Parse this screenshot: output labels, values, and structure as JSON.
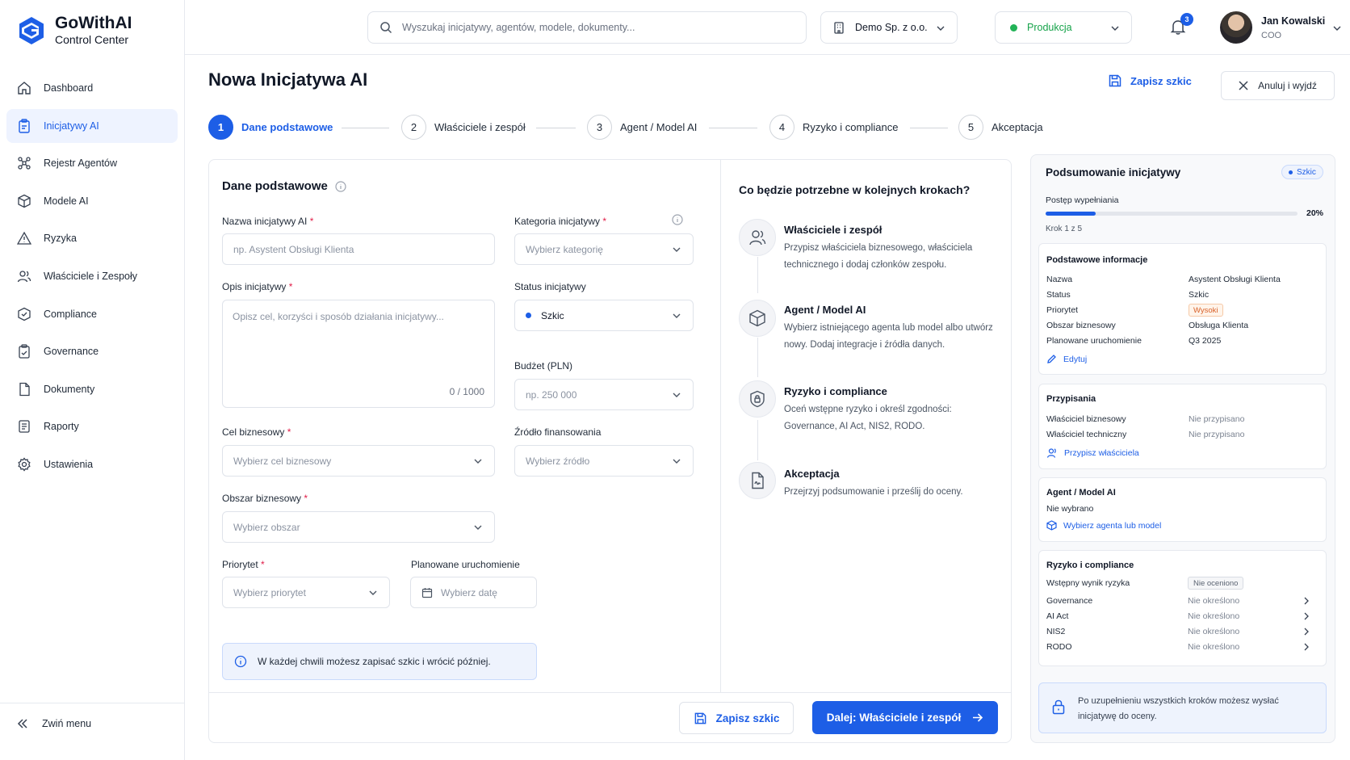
{
  "app": {
    "name": "GoWithAI",
    "subtitle": "Control Center",
    "accent": "#1d5ee6"
  },
  "sidebar": {
    "items": [
      {
        "label": "Dashboard",
        "icon": "home-icon"
      },
      {
        "label": "Inicjatywy AI",
        "icon": "clipboard-icon",
        "active": true
      },
      {
        "label": "Rejestr Agentów",
        "icon": "network-icon"
      },
      {
        "label": "Modele AI",
        "icon": "cube-icon"
      },
      {
        "label": "Ryzyka",
        "icon": "warning-icon"
      },
      {
        "label": "Właściciele i Zespoły",
        "icon": "users-icon"
      },
      {
        "label": "Compliance",
        "icon": "shield-icon"
      },
      {
        "label": "Governance",
        "icon": "clipboard-check-icon"
      },
      {
        "label": "Dokumenty",
        "icon": "document-icon"
      },
      {
        "label": "Raporty",
        "icon": "report-icon"
      },
      {
        "label": "Ustawienia",
        "icon": "gear-icon"
      }
    ],
    "collapse_label": "Zwiń menu"
  },
  "topbar": {
    "search_placeholder": "Wyszukaj inicjatywy, agentów, modele, dokumenty...",
    "org": "Demo Sp. z o.o.",
    "env": "Produkcja",
    "notifications": "3",
    "user_name": "Jan Kowalski",
    "user_role": "COO"
  },
  "page": {
    "title": "Nowa Inicjatywa AI",
    "save_draft": "Zapisz szkic",
    "cancel": "Anuluj i wyjdź"
  },
  "stepper": [
    {
      "num": "1",
      "label": "Dane podstawowe"
    },
    {
      "num": "2",
      "label": "Właściciele i zespół"
    },
    {
      "num": "3",
      "label": "Agent / Model AI"
    },
    {
      "num": "4",
      "label": "Ryzyko i compliance"
    },
    {
      "num": "5",
      "label": "Akceptacja"
    }
  ],
  "form": {
    "section_title": "Dane podstawowe",
    "name": {
      "label": "Nazwa inicjatywy AI",
      "placeholder": "np. Asystent Obsługi Klienta"
    },
    "category": {
      "label": "Kategoria inicjatywy",
      "placeholder": "Wybierz kategorię"
    },
    "description": {
      "label": "Opis inicjatywy",
      "placeholder": "Opisz cel, korzyści i sposób działania inicjatywy...",
      "counter": "0 / 1000"
    },
    "status": {
      "label": "Status inicjatywy",
      "value": "Szkic"
    },
    "budget": {
      "label": "Budżet (PLN)",
      "placeholder": "np. 250 000"
    },
    "goal": {
      "label": "Cel biznesowy",
      "placeholder": "Wybierz cel biznesowy"
    },
    "funding": {
      "label": "Źródło finansowania",
      "placeholder": "Wybierz źródło"
    },
    "area": {
      "label": "Obszar biznesowy",
      "placeholder": "Wybierz obszar"
    },
    "priority": {
      "label": "Priorytet",
      "placeholder": "Wybierz priorytet"
    },
    "launch": {
      "label": "Planowane uruchomienie",
      "placeholder": "Wybierz datę"
    },
    "info": "W każdej chwili możesz zapisać szkic i wrócić później."
  },
  "next_steps": {
    "title": "Co będzie potrzebne w kolejnych krokach?",
    "items": [
      {
        "title": "Właściciele i zespół",
        "desc": "Przypisz właściciela biznesowego, właściciela technicznego i dodaj członków zespołu."
      },
      {
        "title": "Agent / Model AI",
        "desc": "Wybierz istniejącego agenta lub model albo utwórz nowy. Dodaj integracje i źródła danych."
      },
      {
        "title": "Ryzyko i compliance",
        "desc": "Oceń wstępne ryzyko i określ zgodności: Governance, AI Act, NIS2, RODO."
      },
      {
        "title": "Akceptacja",
        "desc": "Przejrzyj podsumowanie i prześlij do oceny."
      }
    ]
  },
  "footer": {
    "save_draft": "Zapisz szkic",
    "next": "Dalej: Właściciele i zespół"
  },
  "summary": {
    "title": "Podsumowanie inicjatywy",
    "badge": "Szkic",
    "progress_label": "Postęp wypełniania",
    "progress": 20,
    "progress_text": "20%",
    "step_text": "Krok 1 z 5",
    "basic": {
      "title": "Podstawowe informacje",
      "rows": [
        {
          "k": "Nazwa",
          "v": "Asystent Obsługi Klienta"
        },
        {
          "k": "Status",
          "v": "Szkic"
        },
        {
          "k": "Priorytet",
          "v": "Wysoki"
        },
        {
          "k": "Obszar biznesowy",
          "v": "Obsługa Klienta"
        },
        {
          "k": "Planowane uruchomienie",
          "v": "Q3 2025"
        }
      ],
      "edit": "Edytuj"
    },
    "assign": {
      "title": "Przypisania",
      "rows": [
        {
          "k": "Właściciel biznesowy",
          "v": "Nie przypisano"
        },
        {
          "k": "Właściciel techniczny",
          "v": "Nie przypisano"
        }
      ],
      "link": "Przypisz właściciela"
    },
    "agent": {
      "title": "Agent / Model AI",
      "value": "Nie wybrano",
      "link": "Wybierz agenta lub model"
    },
    "risk": {
      "title": "Ryzyko i compliance",
      "score_label": "Wstępny wynik ryzyka",
      "score_value": "Nie oceniono",
      "rows": [
        {
          "k": "Governance",
          "v": "Nie określono"
        },
        {
          "k": "AI Act",
          "v": "Nie określono"
        },
        {
          "k": "NIS2",
          "v": "Nie określono"
        },
        {
          "k": "RODO",
          "v": "Nie określono"
        }
      ]
    },
    "note": "Po uzupełnieniu wszystkich kroków możesz wysłać inicjatywę do oceny."
  }
}
